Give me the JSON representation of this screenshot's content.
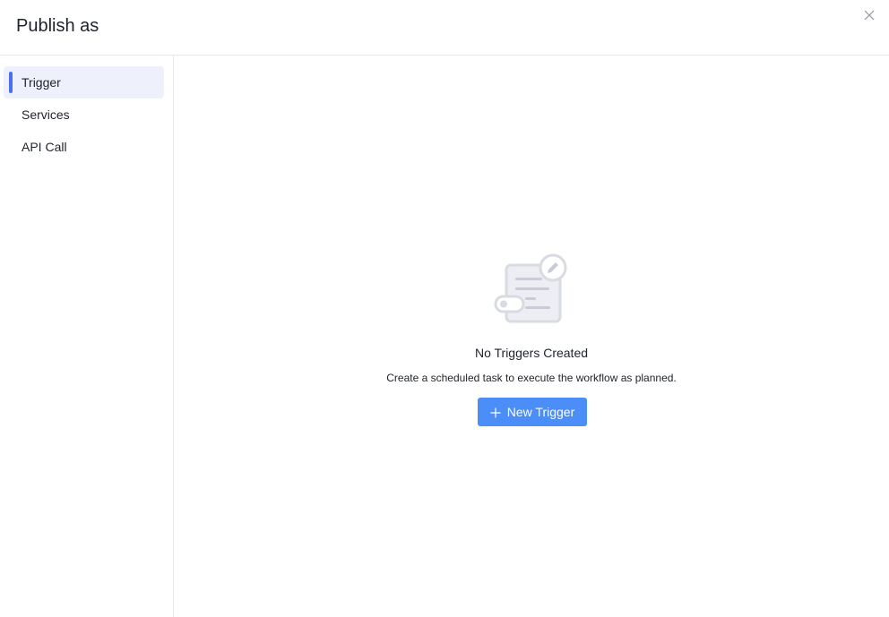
{
  "dialog": {
    "title": "Publish as",
    "close_icon": "close-icon"
  },
  "sidebar": {
    "items": [
      {
        "label": "Trigger",
        "active": true
      },
      {
        "label": "Services",
        "active": false
      },
      {
        "label": "API Call",
        "active": false
      }
    ]
  },
  "main": {
    "empty_state": {
      "illustration_icon": "document-edit-icon",
      "title": "No Triggers Created",
      "description": "Create a scheduled task to execute the workflow as planned.",
      "button_label": "New Trigger",
      "button_icon": "plus-icon"
    }
  },
  "colors": {
    "accent": "#4e6ef2",
    "button": "#4c8ef7",
    "active_item_bg": "#eef1fb",
    "border": "#e5e6eb"
  }
}
